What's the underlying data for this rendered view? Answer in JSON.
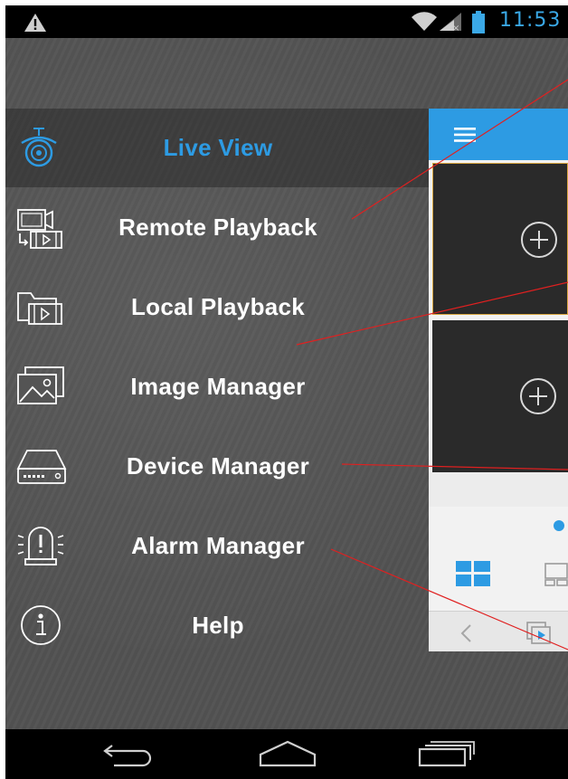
{
  "status_bar": {
    "time": "11:53",
    "icons": [
      "warning-icon",
      "wifi-icon",
      "signal-icon",
      "battery-icon"
    ]
  },
  "drawer": {
    "items": [
      {
        "label": "Live View",
        "icon": "camera-icon",
        "active": true
      },
      {
        "label": "Remote Playback",
        "icon": "remote-playback-icon",
        "active": false
      },
      {
        "label": "Local Playback",
        "icon": "local-playback-icon",
        "active": false
      },
      {
        "label": "Image Manager",
        "icon": "image-icon",
        "active": false
      },
      {
        "label": "Device Manager",
        "icon": "dvr-device-icon",
        "active": false
      },
      {
        "label": "Alarm Manager",
        "icon": "alarm-icon",
        "active": false
      },
      {
        "label": "Help",
        "icon": "info-icon",
        "active": false
      }
    ]
  },
  "live_panel": {
    "header_icon": "hamburger-menu-icon",
    "cells": [
      "add-channel-icon",
      "add-channel-icon"
    ],
    "toolbar_icons": [
      "grid-layout-icon",
      "multi-screen-icon"
    ],
    "bottom_icons": [
      "back-chevron-icon",
      "playback-icon"
    ]
  },
  "nav_bar": {
    "icons": [
      "back-icon",
      "home-icon",
      "recent-apps-icon"
    ]
  },
  "colors": {
    "accent": "#2d9be3",
    "drawer_bg": "#535353",
    "status_text": "#3aa8e6",
    "annotation_line": "#e02020",
    "cell_highlight": "#d8a640"
  }
}
